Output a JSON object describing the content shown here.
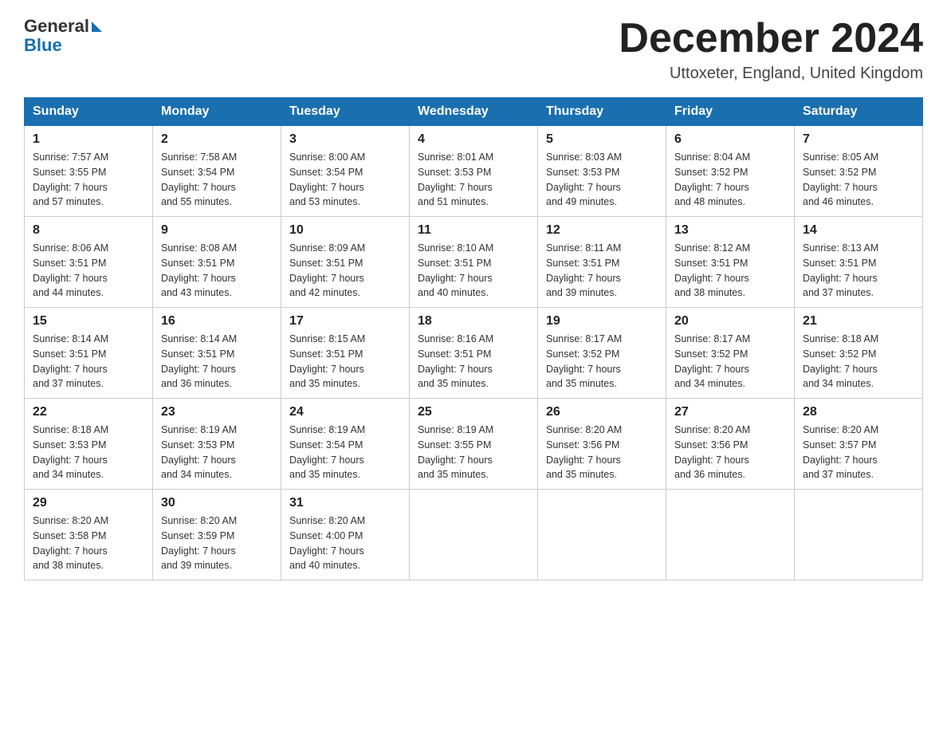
{
  "header": {
    "logo": {
      "general_text": "General",
      "blue_text": "Blue"
    },
    "title": "December 2024",
    "location": "Uttoxeter, England, United Kingdom"
  },
  "columns": [
    "Sunday",
    "Monday",
    "Tuesday",
    "Wednesday",
    "Thursday",
    "Friday",
    "Saturday"
  ],
  "weeks": [
    [
      {
        "day": "1",
        "sunrise": "7:57 AM",
        "sunset": "3:55 PM",
        "daylight": "7 hours and 57 minutes."
      },
      {
        "day": "2",
        "sunrise": "7:58 AM",
        "sunset": "3:54 PM",
        "daylight": "7 hours and 55 minutes."
      },
      {
        "day": "3",
        "sunrise": "8:00 AM",
        "sunset": "3:54 PM",
        "daylight": "7 hours and 53 minutes."
      },
      {
        "day": "4",
        "sunrise": "8:01 AM",
        "sunset": "3:53 PM",
        "daylight": "7 hours and 51 minutes."
      },
      {
        "day": "5",
        "sunrise": "8:03 AM",
        "sunset": "3:53 PM",
        "daylight": "7 hours and 49 minutes."
      },
      {
        "day": "6",
        "sunrise": "8:04 AM",
        "sunset": "3:52 PM",
        "daylight": "7 hours and 48 minutes."
      },
      {
        "day": "7",
        "sunrise": "8:05 AM",
        "sunset": "3:52 PM",
        "daylight": "7 hours and 46 minutes."
      }
    ],
    [
      {
        "day": "8",
        "sunrise": "8:06 AM",
        "sunset": "3:51 PM",
        "daylight": "7 hours and 44 minutes."
      },
      {
        "day": "9",
        "sunrise": "8:08 AM",
        "sunset": "3:51 PM",
        "daylight": "7 hours and 43 minutes."
      },
      {
        "day": "10",
        "sunrise": "8:09 AM",
        "sunset": "3:51 PM",
        "daylight": "7 hours and 42 minutes."
      },
      {
        "day": "11",
        "sunrise": "8:10 AM",
        "sunset": "3:51 PM",
        "daylight": "7 hours and 40 minutes."
      },
      {
        "day": "12",
        "sunrise": "8:11 AM",
        "sunset": "3:51 PM",
        "daylight": "7 hours and 39 minutes."
      },
      {
        "day": "13",
        "sunrise": "8:12 AM",
        "sunset": "3:51 PM",
        "daylight": "7 hours and 38 minutes."
      },
      {
        "day": "14",
        "sunrise": "8:13 AM",
        "sunset": "3:51 PM",
        "daylight": "7 hours and 37 minutes."
      }
    ],
    [
      {
        "day": "15",
        "sunrise": "8:14 AM",
        "sunset": "3:51 PM",
        "daylight": "7 hours and 37 minutes."
      },
      {
        "day": "16",
        "sunrise": "8:14 AM",
        "sunset": "3:51 PM",
        "daylight": "7 hours and 36 minutes."
      },
      {
        "day": "17",
        "sunrise": "8:15 AM",
        "sunset": "3:51 PM",
        "daylight": "7 hours and 35 minutes."
      },
      {
        "day": "18",
        "sunrise": "8:16 AM",
        "sunset": "3:51 PM",
        "daylight": "7 hours and 35 minutes."
      },
      {
        "day": "19",
        "sunrise": "8:17 AM",
        "sunset": "3:52 PM",
        "daylight": "7 hours and 35 minutes."
      },
      {
        "day": "20",
        "sunrise": "8:17 AM",
        "sunset": "3:52 PM",
        "daylight": "7 hours and 34 minutes."
      },
      {
        "day": "21",
        "sunrise": "8:18 AM",
        "sunset": "3:52 PM",
        "daylight": "7 hours and 34 minutes."
      }
    ],
    [
      {
        "day": "22",
        "sunrise": "8:18 AM",
        "sunset": "3:53 PM",
        "daylight": "7 hours and 34 minutes."
      },
      {
        "day": "23",
        "sunrise": "8:19 AM",
        "sunset": "3:53 PM",
        "daylight": "7 hours and 34 minutes."
      },
      {
        "day": "24",
        "sunrise": "8:19 AM",
        "sunset": "3:54 PM",
        "daylight": "7 hours and 35 minutes."
      },
      {
        "day": "25",
        "sunrise": "8:19 AM",
        "sunset": "3:55 PM",
        "daylight": "7 hours and 35 minutes."
      },
      {
        "day": "26",
        "sunrise": "8:20 AM",
        "sunset": "3:56 PM",
        "daylight": "7 hours and 35 minutes."
      },
      {
        "day": "27",
        "sunrise": "8:20 AM",
        "sunset": "3:56 PM",
        "daylight": "7 hours and 36 minutes."
      },
      {
        "day": "28",
        "sunrise": "8:20 AM",
        "sunset": "3:57 PM",
        "daylight": "7 hours and 37 minutes."
      }
    ],
    [
      {
        "day": "29",
        "sunrise": "8:20 AM",
        "sunset": "3:58 PM",
        "daylight": "7 hours and 38 minutes."
      },
      {
        "day": "30",
        "sunrise": "8:20 AM",
        "sunset": "3:59 PM",
        "daylight": "7 hours and 39 minutes."
      },
      {
        "day": "31",
        "sunrise": "8:20 AM",
        "sunset": "4:00 PM",
        "daylight": "7 hours and 40 minutes."
      },
      null,
      null,
      null,
      null
    ]
  ],
  "labels": {
    "sunrise": "Sunrise:",
    "sunset": "Sunset:",
    "daylight": "Daylight:"
  }
}
